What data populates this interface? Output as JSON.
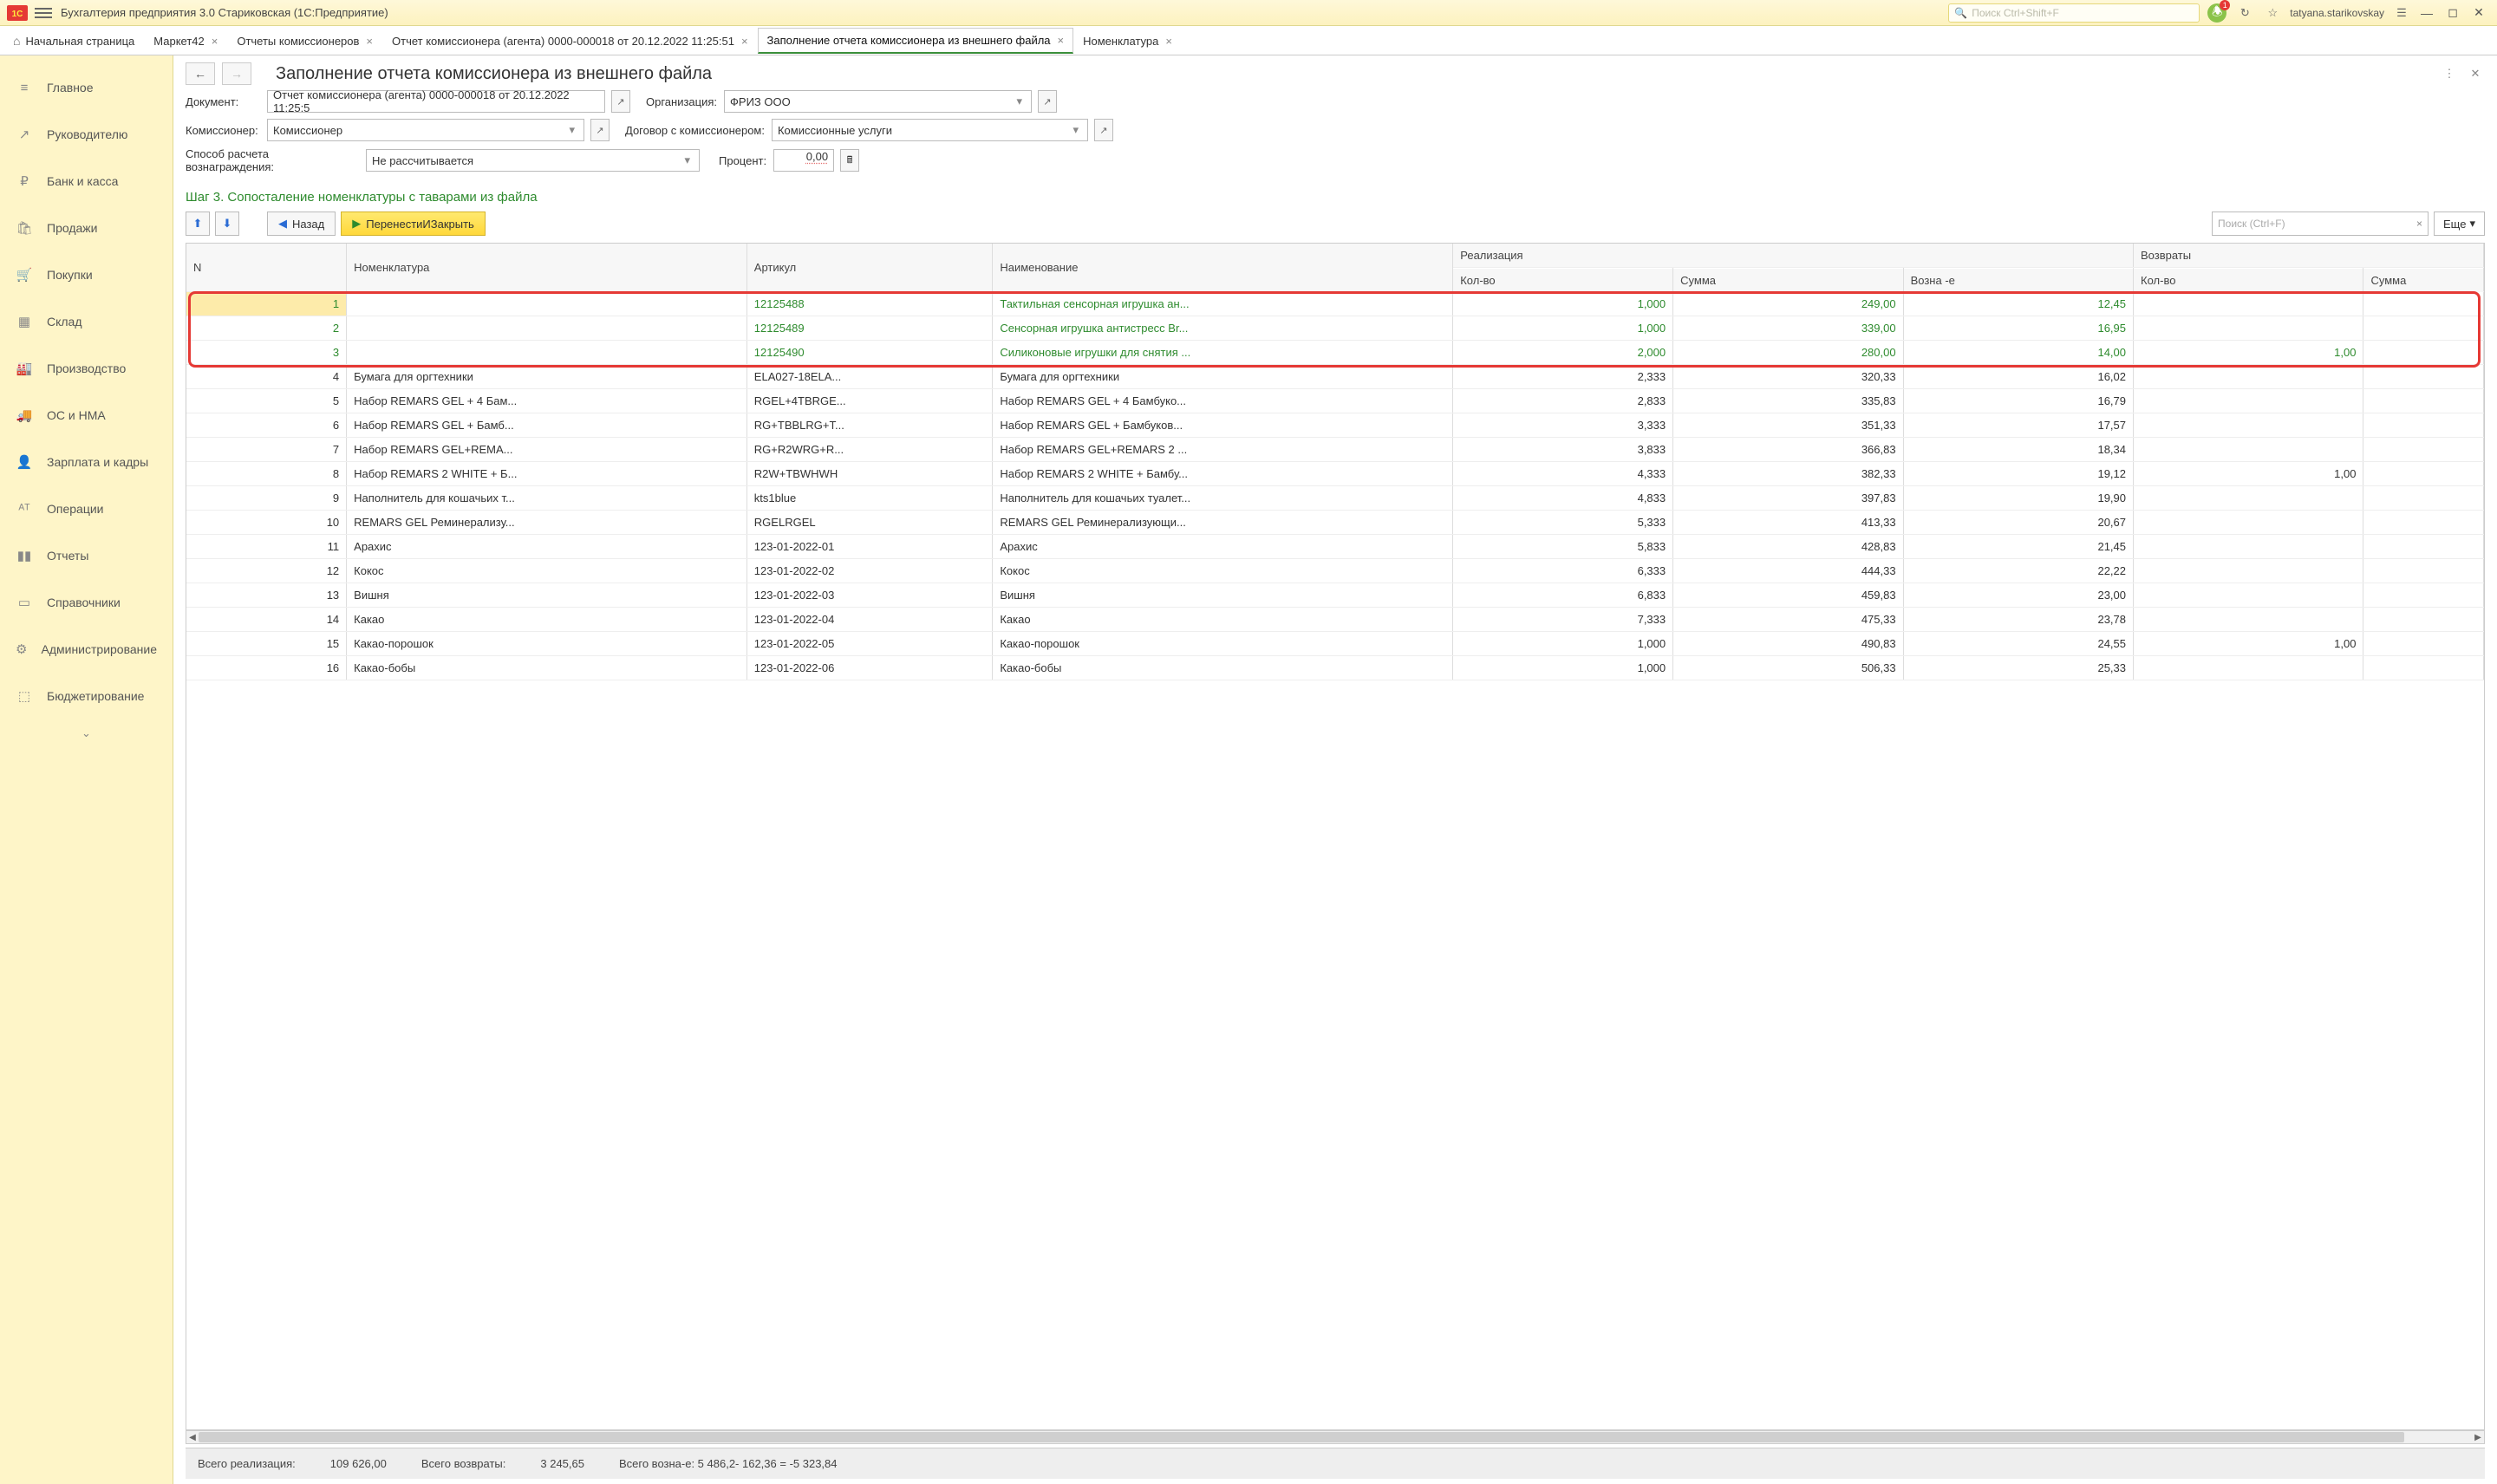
{
  "titlebar": {
    "app_title": "Бухгалтерия предприятия 3.0 Стариковская  (1С:Предприятие)",
    "search_placeholder": "Поиск Ctrl+Shift+F",
    "username": "tatyana.starikovskay",
    "notif_count": "1"
  },
  "tabs": [
    {
      "label": "Начальная страница",
      "home": true,
      "closable": false
    },
    {
      "label": "Маркет42",
      "closable": true
    },
    {
      "label": "Отчеты комиссионеров",
      "closable": true
    },
    {
      "label": "Отчет комиссионера (агента) 0000-000018 от 20.12.2022 11:25:51",
      "closable": true
    },
    {
      "label": "Заполнение  отчета комиссионера из внешнего  файла",
      "closable": true,
      "active": true
    },
    {
      "label": "Номенклатура",
      "closable": true
    }
  ],
  "sidebar": {
    "items": [
      {
        "icon": "≡",
        "label": "Главное"
      },
      {
        "icon": "↗",
        "label": "Руководителю"
      },
      {
        "icon": "₽",
        "label": "Банк и касса"
      },
      {
        "icon": "🛍",
        "label": "Продажи"
      },
      {
        "icon": "🛒",
        "label": "Покупки"
      },
      {
        "icon": "▦",
        "label": "Склад"
      },
      {
        "icon": "🏭",
        "label": "Производство"
      },
      {
        "icon": "🚚",
        "label": "ОС и НМА"
      },
      {
        "icon": "👤",
        "label": "Зарплата и кадры"
      },
      {
        "icon": "ᴬᵀ",
        "label": "Операции"
      },
      {
        "icon": "▮▮",
        "label": "Отчеты"
      },
      {
        "icon": "▭",
        "label": "Справочники"
      },
      {
        "icon": "⚙",
        "label": "Администрирование"
      },
      {
        "icon": "⬚",
        "label": "Бюджетирование"
      }
    ]
  },
  "page": {
    "title": "Заполнение  отчета комиссионера из внешнего  файла",
    "labels": {
      "document": "Документ:",
      "organization": "Организация:",
      "commissioner": "Комиссионер:",
      "contract": "Договор с комиссионером:",
      "calc_method": "Способ расчета вознаграждения:",
      "percent": "Процент:"
    },
    "values": {
      "document": "Отчет комиссионера (агента) 0000-000018 от 20.12.2022 11:25:5",
      "organization": "ФРИЗ ООО",
      "commissioner": "Комиссионер",
      "contract": "Комиссионные услуги",
      "calc_method": "Не рассчитывается",
      "percent": "0,00"
    },
    "step_title": "Шаг 3. Сопосталение номенклатуры с таварами из файла",
    "buttons": {
      "back": "Назад",
      "transfer": "ПеренестиИЗакрыть",
      "more": "Еще",
      "search_placeholder": "Поиск (Ctrl+F)"
    }
  },
  "table": {
    "headers": {
      "n": "N",
      "nomenclature": "Номенклатура",
      "article": "Артикул",
      "name": "Наименование",
      "realization": "Реализация",
      "returns": "Возвраты",
      "qty": "Кол-во",
      "sum": "Сумма",
      "reward": "Возна -е"
    },
    "rows": [
      {
        "n": "1",
        "nom": "",
        "art": "12125488",
        "name": "Тактильная сенсорная игрушка ан...",
        "qty": "1,000",
        "sum": "249,00",
        "rew": "12,45",
        "rqty": "",
        "rsum": "",
        "green": true,
        "sel": true
      },
      {
        "n": "2",
        "nom": "",
        "art": "12125489",
        "name": "Сенсорная игрушка антистресс Br...",
        "qty": "1,000",
        "sum": "339,00",
        "rew": "16,95",
        "rqty": "",
        "rsum": "",
        "green": true
      },
      {
        "n": "3",
        "nom": "",
        "art": "12125490",
        "name": "Силиконовые игрушки для снятия ...",
        "qty": "2,000",
        "sum": "280,00",
        "rew": "14,00",
        "rqty": "1,00",
        "rsum": "",
        "green": true
      },
      {
        "n": "4",
        "nom": "Бумага для оргтехники",
        "art": "ELA027-18ELA...",
        "name": "Бумага для оргтехники",
        "qty": "2,333",
        "sum": "320,33",
        "rew": "16,02",
        "rqty": "",
        "rsum": ""
      },
      {
        "n": "5",
        "nom": "Набор REMARS GEL + 4 Бам...",
        "art": "RGEL+4TBRGE...",
        "name": "Набор REMARS GEL + 4 Бамбуко...",
        "qty": "2,833",
        "sum": "335,83",
        "rew": "16,79",
        "rqty": "",
        "rsum": ""
      },
      {
        "n": "6",
        "nom": "Набор REMARS GEL + Бамб...",
        "art": "RG+TBBLRG+T...",
        "name": "Набор REMARS GEL + Бамбуков...",
        "qty": "3,333",
        "sum": "351,33",
        "rew": "17,57",
        "rqty": "",
        "rsum": ""
      },
      {
        "n": "7",
        "nom": "Набор REMARS GEL+REMA...",
        "art": "RG+R2WRG+R...",
        "name": "Набор REMARS GEL+REMARS 2 ...",
        "qty": "3,833",
        "sum": "366,83",
        "rew": "18,34",
        "rqty": "",
        "rsum": ""
      },
      {
        "n": "8",
        "nom": "Набор REMARS 2 WHITE + Б...",
        "art": "R2W+TBWHWH",
        "name": "Набор REMARS 2 WHITE + Бамбу...",
        "qty": "4,333",
        "sum": "382,33",
        "rew": "19,12",
        "rqty": "1,00",
        "rsum": ""
      },
      {
        "n": "9",
        "nom": "Наполнитель для кошачьих т...",
        "art": "kts1blue",
        "name": "Наполнитель для кошачьих туалет...",
        "qty": "4,833",
        "sum": "397,83",
        "rew": "19,90",
        "rqty": "",
        "rsum": ""
      },
      {
        "n": "10",
        "nom": "REMARS GEL Реминерализу...",
        "art": "RGELRGEL",
        "name": "REMARS GEL Реминерализующи...",
        "qty": "5,333",
        "sum": "413,33",
        "rew": "20,67",
        "rqty": "",
        "rsum": ""
      },
      {
        "n": "11",
        "nom": "Арахис",
        "art": "123-01-2022-01",
        "name": "Арахис",
        "qty": "5,833",
        "sum": "428,83",
        "rew": "21,45",
        "rqty": "",
        "rsum": ""
      },
      {
        "n": "12",
        "nom": "Кокос",
        "art": "123-01-2022-02",
        "name": "Кокос",
        "qty": "6,333",
        "sum": "444,33",
        "rew": "22,22",
        "rqty": "",
        "rsum": ""
      },
      {
        "n": "13",
        "nom": "Вишня",
        "art": "123-01-2022-03",
        "name": "Вишня",
        "qty": "6,833",
        "sum": "459,83",
        "rew": "23,00",
        "rqty": "",
        "rsum": ""
      },
      {
        "n": "14",
        "nom": "Какао",
        "art": "123-01-2022-04",
        "name": "Какао",
        "qty": "7,333",
        "sum": "475,33",
        "rew": "23,78",
        "rqty": "",
        "rsum": ""
      },
      {
        "n": "15",
        "nom": "Какао-порошок",
        "art": "123-01-2022-05",
        "name": "Какао-порошок",
        "qty": "1,000",
        "sum": "490,83",
        "rew": "24,55",
        "rqty": "1,00",
        "rsum": ""
      },
      {
        "n": "16",
        "nom": "Какао-бобы",
        "art": "123-01-2022-06",
        "name": "Какао-бобы",
        "qty": "1,000",
        "sum": "506,33",
        "rew": "25,33",
        "rqty": "",
        "rsum": ""
      }
    ]
  },
  "footer": {
    "total_real_label": "Всего реализация:",
    "total_real_value": "109 626,00",
    "total_ret_label": "Всего возвраты:",
    "total_ret_value": "3 245,65",
    "total_rew": "Всего возна-е: 5 486,2- 162,36 = -5 323,84"
  }
}
